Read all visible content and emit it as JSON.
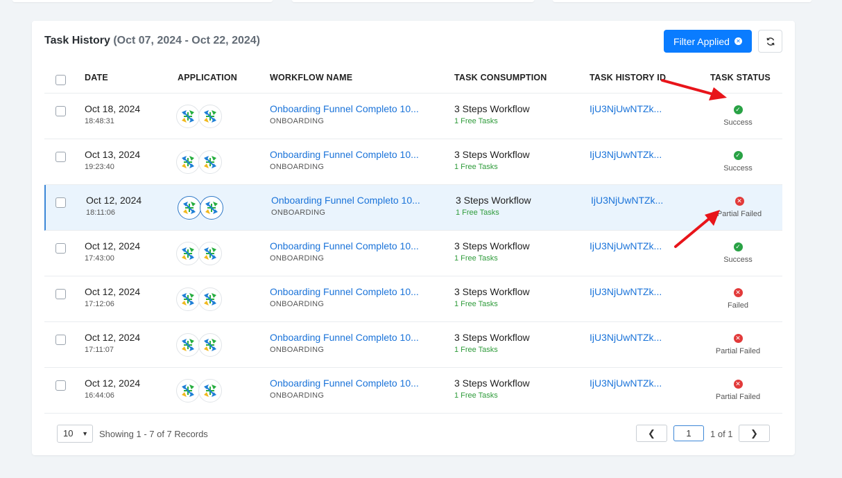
{
  "header": {
    "title": "Task History",
    "date_range": "(Oct 07, 2024 - Oct 22, 2024)",
    "filter_button_label": "Filter Applied"
  },
  "columns": {
    "date": "DATE",
    "application": "APPLICATION",
    "workflow_name": "WORKFLOW NAME",
    "task_consumption": "TASK CONSUMPTION",
    "task_history_id": "TASK HISTORY ID",
    "task_status": "TASK STATUS"
  },
  "rows": [
    {
      "date": "Oct 18, 2024",
      "time": "18:48:31",
      "workflow": "Onboarding Funnel Completo 10...",
      "workflow_sub": "ONBOARDING",
      "consumption": "3 Steps Workflow",
      "consumption_sub": "1 Free Tasks",
      "history_id": "IjU3NjUwNTZk...",
      "status": "Success",
      "status_type": "success"
    },
    {
      "date": "Oct 13, 2024",
      "time": "19:23:40",
      "workflow": "Onboarding Funnel Completo 10...",
      "workflow_sub": "ONBOARDING",
      "consumption": "3 Steps Workflow",
      "consumption_sub": "1 Free Tasks",
      "history_id": "IjU3NjUwNTZk...",
      "status": "Success",
      "status_type": "success"
    },
    {
      "date": "Oct 12, 2024",
      "time": "18:11:06",
      "workflow": "Onboarding Funnel Completo 10...",
      "workflow_sub": "ONBOARDING",
      "consumption": "3 Steps Workflow",
      "consumption_sub": "1 Free Tasks",
      "history_id": "IjU3NjUwNTZk...",
      "status": "Partial Failed",
      "status_type": "failed"
    },
    {
      "date": "Oct 12, 2024",
      "time": "17:43:00",
      "workflow": "Onboarding Funnel Completo 10...",
      "workflow_sub": "ONBOARDING",
      "consumption": "3 Steps Workflow",
      "consumption_sub": "1 Free Tasks",
      "history_id": "IjU3NjUwNTZk...",
      "status": "Success",
      "status_type": "success"
    },
    {
      "date": "Oct 12, 2024",
      "time": "17:12:06",
      "workflow": "Onboarding Funnel Completo 10...",
      "workflow_sub": "ONBOARDING",
      "consumption": "3 Steps Workflow",
      "consumption_sub": "1 Free Tasks",
      "history_id": "IjU3NjUwNTZk...",
      "status": "Failed",
      "status_type": "failed"
    },
    {
      "date": "Oct 12, 2024",
      "time": "17:11:07",
      "workflow": "Onboarding Funnel Completo 10...",
      "workflow_sub": "ONBOARDING",
      "consumption": "3 Steps Workflow",
      "consumption_sub": "1 Free Tasks",
      "history_id": "IjU3NjUwNTZk...",
      "status": "Partial Failed",
      "status_type": "failed"
    },
    {
      "date": "Oct 12, 2024",
      "time": "16:44:06",
      "workflow": "Onboarding Funnel Completo 10...",
      "workflow_sub": "ONBOARDING",
      "consumption": "3 Steps Workflow",
      "consumption_sub": "1 Free Tasks",
      "history_id": "IjU3NjUwNTZk...",
      "status": "Partial Failed",
      "status_type": "failed"
    }
  ],
  "footer": {
    "page_size": "10",
    "showing": "Showing 1 - 7 of 7 Records",
    "current_page": "1",
    "page_of": "1 of 1"
  },
  "colors": {
    "accent": "#0a7cff",
    "link": "#1a73d9",
    "success": "#29a245",
    "failed": "#e23a3a",
    "annotation_arrow": "#e8141a"
  }
}
